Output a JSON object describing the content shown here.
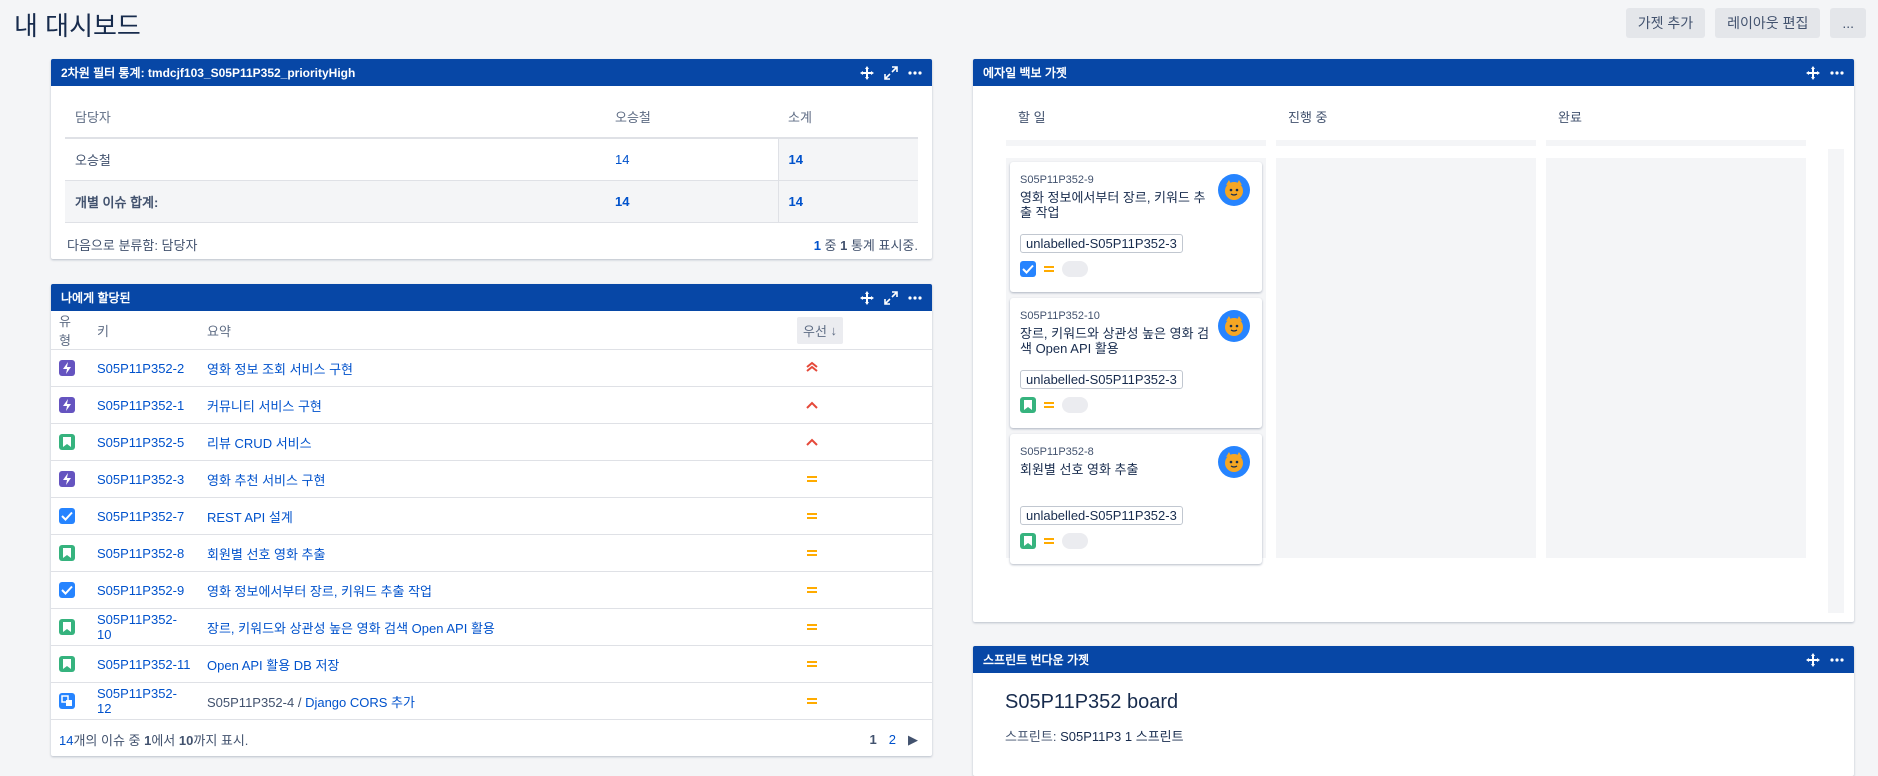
{
  "page": {
    "title": "내 대시보드"
  },
  "top_actions": {
    "add_gadget": "가젯 추가",
    "edit_layout": "레이아웃 편집",
    "more": "..."
  },
  "filter_gadget": {
    "title": "2차원 필터 통계: tmdcjf103_S05P11P352_priorityHigh",
    "col_assignee": "담당자",
    "col_user": "오승철",
    "col_subtotal": "소계",
    "row_user": "오승철",
    "row_user_val": "14",
    "row_user_sub": "14",
    "row_total": "개별 이슈 합계:",
    "row_total_val": "14",
    "row_total_sub": "14",
    "group_by": "다음으로 분류함: 담당자",
    "stats_a": "1",
    "stats_b": " 중 ",
    "stats_c": "1",
    "stats_d": " 통계 표시중."
  },
  "assigned_gadget": {
    "title": "나에게 할당된",
    "col_type": "유형",
    "col_key": "키",
    "col_summary": "요약",
    "col_priority": "우선",
    "rows": [
      {
        "type": "epic",
        "key": "S05P11P352-2",
        "parent": "",
        "summary": "영화 정보 조회 서비스 구현",
        "priority": "highest"
      },
      {
        "type": "epic",
        "key": "S05P11P352-1",
        "parent": "",
        "summary": "커뮤니티 서비스 구현",
        "priority": "high"
      },
      {
        "type": "story",
        "key": "S05P11P352-5",
        "parent": "",
        "summary": "리뷰 CRUD 서비스",
        "priority": "high"
      },
      {
        "type": "epic",
        "key": "S05P11P352-3",
        "parent": "",
        "summary": "영화 추천 서비스 구현",
        "priority": "medium"
      },
      {
        "type": "task",
        "key": "S05P11P352-7",
        "parent": "",
        "summary": "REST API 설계",
        "priority": "medium"
      },
      {
        "type": "story",
        "key": "S05P11P352-8",
        "parent": "",
        "summary": "회원별 선호 영화 추출",
        "priority": "medium"
      },
      {
        "type": "task",
        "key": "S05P11P352-9",
        "parent": "",
        "summary": "영화 정보에서부터 장르, 키워드 추출 작업",
        "priority": "medium"
      },
      {
        "type": "story",
        "key": "S05P11P352-10",
        "parent": "",
        "summary": "장르, 키워드와 상관성 높은 영화 검색 Open API 활용",
        "priority": "medium"
      },
      {
        "type": "story",
        "key": "S05P11P352-11",
        "parent": "",
        "summary": "Open API 활용 DB 저장",
        "priority": "medium"
      },
      {
        "type": "subtask",
        "key": "S05P11P352-12",
        "parent": "S05P11P352-4 / ",
        "summary": "Django CORS 추가",
        "priority": "medium"
      }
    ],
    "footer_a": "14",
    "footer_b": "개의 이슈 중 ",
    "footer_c": "1",
    "footer_d": "에서 ",
    "footer_e": "10",
    "footer_f": "까지 표시.",
    "page_current": "1",
    "page_next": "2"
  },
  "agile_gadget": {
    "title": "에자일 백보 가젯",
    "columns": [
      "할 일",
      "진행 중",
      "완료"
    ],
    "cards": [
      {
        "key": "S05P11P352-9",
        "summary": "영화 정보에서부터 장르, 키워드 추출 작업",
        "label": "unlabelled-S05P11P352-3",
        "type": "task"
      },
      {
        "key": "S05P11P352-10",
        "summary": "장르, 키워드와 상관성 높은 영화 검색 Open API 활용",
        "label": "unlabelled-S05P11P352-3",
        "type": "story"
      },
      {
        "key": "S05P11P352-8",
        "summary": "회원별 선호 영화 추출",
        "label": "unlabelled-S05P11P352-3",
        "type": "story"
      }
    ]
  },
  "sprint_gadget": {
    "title": "스프린트 번다운 가젯",
    "board": "S05P11P352 board",
    "sprint_label": "스프린트: ",
    "sprint_value": "S05P11P3 1 스프린트"
  },
  "colors": {
    "header": "#0747a6",
    "link": "#0052cc",
    "epic": "#6554c0",
    "story": "#36b37e",
    "task": "#2684ff",
    "priority_high": "#e5493a",
    "priority_medium": "#ffab00"
  }
}
